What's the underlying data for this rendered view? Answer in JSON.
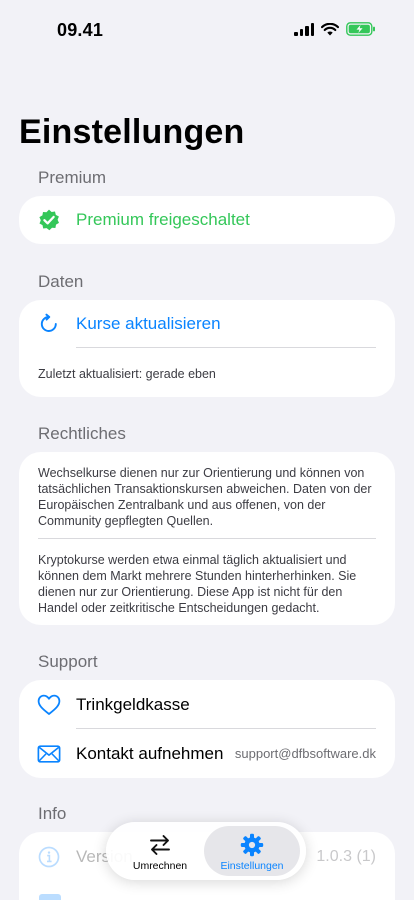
{
  "status_bar": {
    "time": "09.41"
  },
  "page_title": "Einstellungen",
  "premium": {
    "header": "Premium",
    "status_label": "Premium freigeschaltet",
    "accent": "#34c759"
  },
  "data_section": {
    "header": "Daten",
    "refresh_label": "Kurse aktualisieren",
    "last_updated": "Zuletzt aktualisiert: gerade eben",
    "accent": "#0a84ff"
  },
  "legal": {
    "header": "Rechtliches",
    "paragraph1": "Wechselkurse dienen nur zur Orientierung und können von tatsächlichen Transaktionskursen abweichen. Daten von der Europäischen Zentralbank und aus offenen, von der Community gepflegten Quellen.",
    "paragraph2": "Kryptokurse werden etwa einmal täglich aktualisiert und können dem Markt mehrere Stunden hinterherhinken. Sie dienen nur zur Orientierung. Diese App ist nicht für den Handel oder zeitkritische Entscheidungen gedacht."
  },
  "support": {
    "header": "Support",
    "tip_jar_label": "Trinkgeldkasse",
    "contact_label": "Kontakt aufnehmen",
    "contact_email": "support@dfbsoftware.dk"
  },
  "info": {
    "header": "Info",
    "version_label": "Version",
    "version_value": "1.0.3 (1)"
  },
  "tabbar": {
    "tabs": [
      {
        "label": "Umrechnen",
        "icon": "arrows-exchange-icon",
        "selected": false
      },
      {
        "label": "Einstellungen",
        "icon": "gear-icon",
        "selected": true
      }
    ],
    "accent": "#0a84ff"
  }
}
